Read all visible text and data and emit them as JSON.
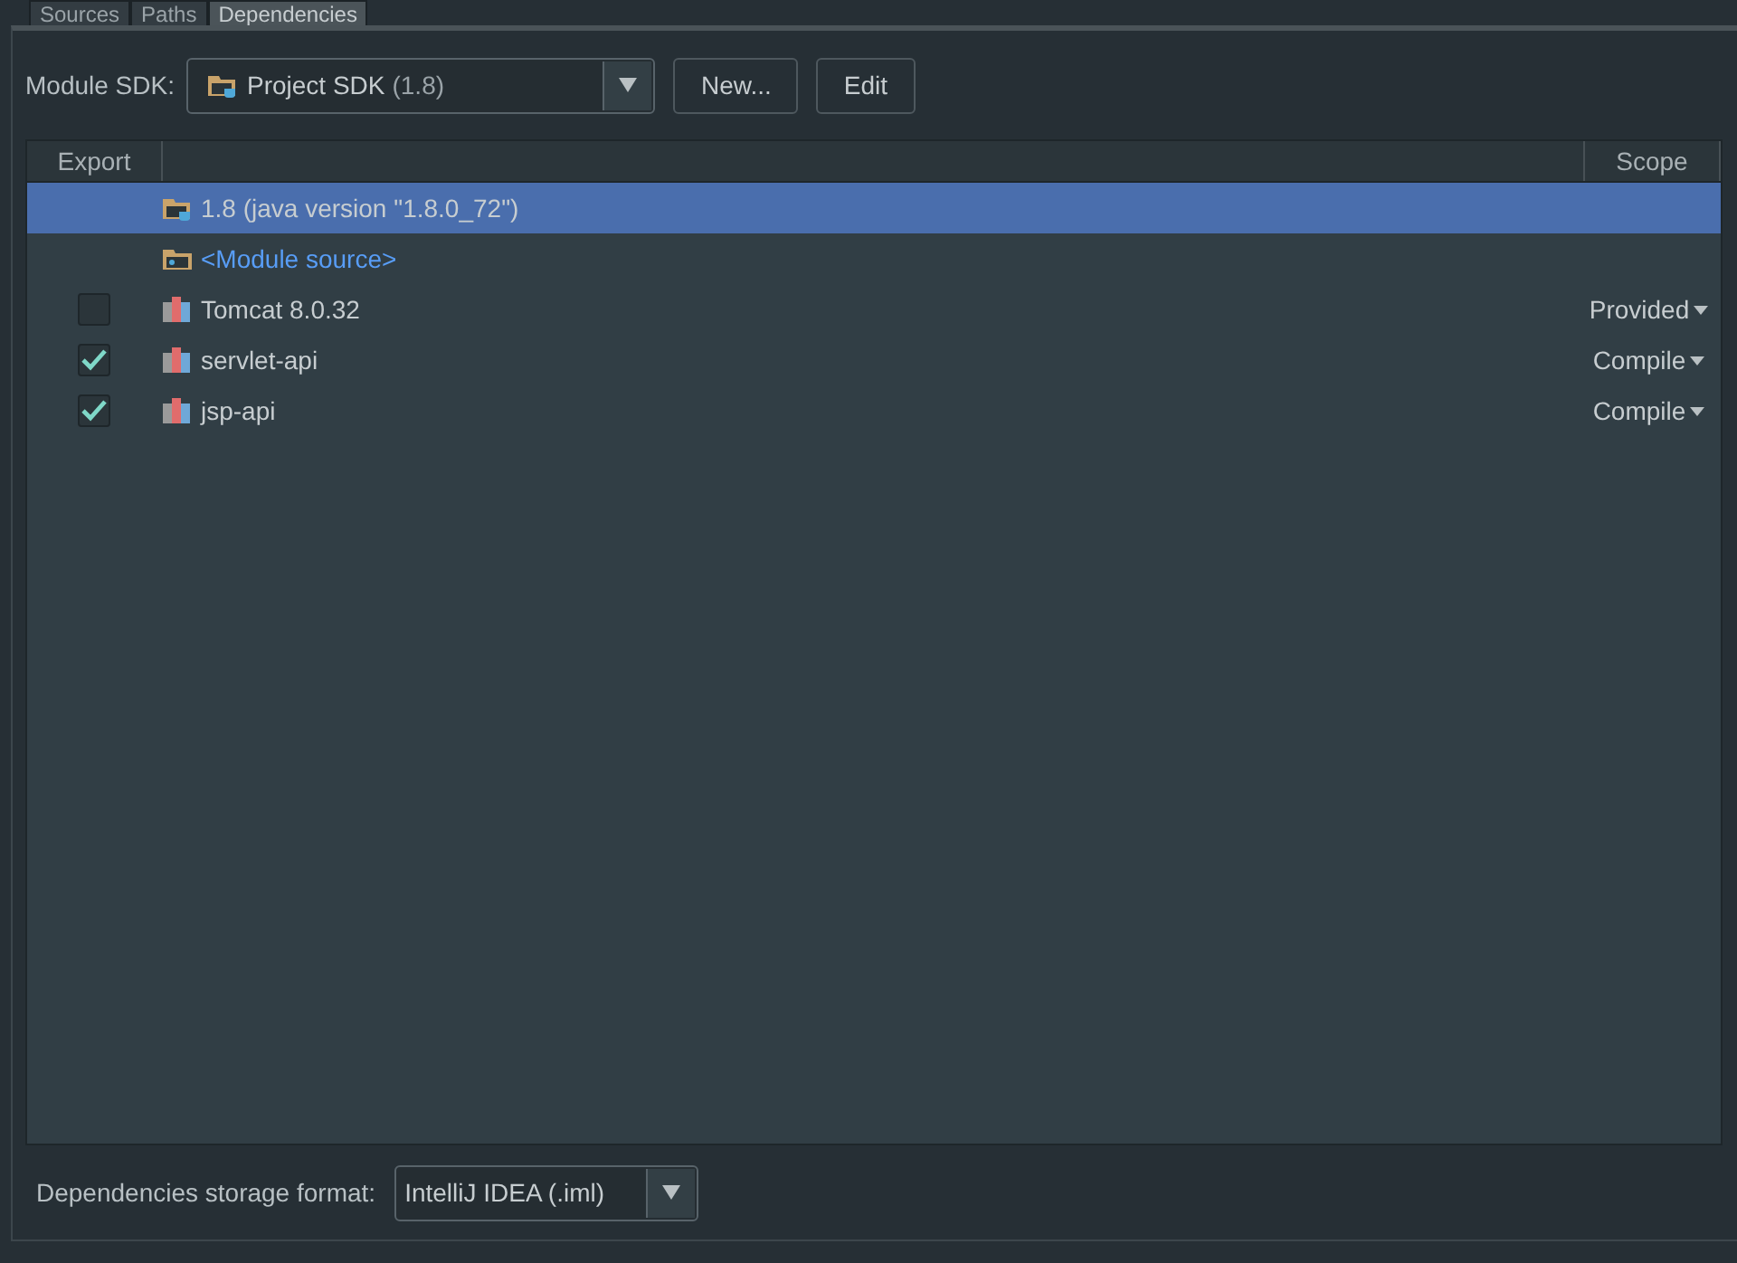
{
  "tabs": [
    {
      "label": "Sources",
      "selected": false
    },
    {
      "label": "Paths",
      "selected": false
    },
    {
      "label": "Dependencies",
      "selected": true
    }
  ],
  "module_sdk": {
    "label": "Module SDK:",
    "value": "Project SDK",
    "version": "(1.8)",
    "buttons": [
      "New...",
      "Edit"
    ]
  },
  "table": {
    "columns": [
      "Export",
      "Scope"
    ],
    "rows": [
      {
        "kind": "sdk",
        "name": "1.8 (java version \"1.8.0_72\")",
        "selected": true
      },
      {
        "kind": "source",
        "name": "<Module source>",
        "selected": false
      },
      {
        "kind": "library",
        "name": "Tomcat 8.0.32",
        "checked": false,
        "scope": "Provided",
        "selected": false
      },
      {
        "kind": "library",
        "name": "servlet-api",
        "checked": true,
        "scope": "Compile",
        "selected": false
      },
      {
        "kind": "library",
        "name": "jsp-api",
        "checked": true,
        "scope": "Compile",
        "selected": false
      }
    ]
  },
  "storage_format": {
    "label": "Dependencies storage format:",
    "value": "IntelliJ IDEA (.iml)"
  }
}
